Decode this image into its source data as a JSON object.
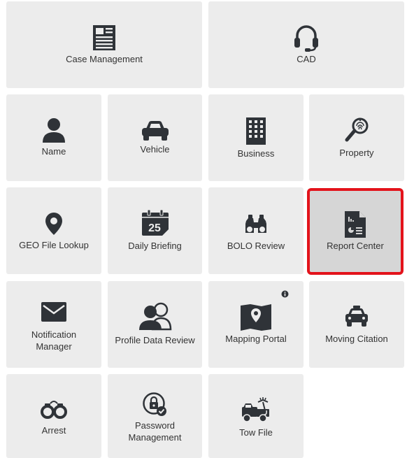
{
  "colors": {
    "tile_bg": "#ececec",
    "icon": "#2f3338",
    "selected_bg": "#d6d6d6",
    "selected_border": "#e3131b"
  },
  "tiles": {
    "case_management": {
      "label": "Case Management",
      "icon": "document-icon"
    },
    "cad": {
      "label": "CAD",
      "icon": "headset-icon"
    },
    "name": {
      "label": "Name",
      "icon": "person-icon"
    },
    "vehicle": {
      "label": "Vehicle",
      "icon": "car-icon"
    },
    "business": {
      "label": "Business",
      "icon": "building-icon"
    },
    "property": {
      "label": "Property",
      "icon": "fingerprint-magnifier-icon"
    },
    "geo_file_lookup": {
      "label": "GEO File Lookup",
      "icon": "map-pin-icon"
    },
    "daily_briefing": {
      "label": "Daily Briefing",
      "icon": "calendar-icon",
      "calendar_day": "25"
    },
    "bolo_review": {
      "label": "BOLO Review",
      "icon": "binoculars-icon"
    },
    "report_center": {
      "label": "Report Center",
      "icon": "report-chart-icon",
      "selected": true
    },
    "notification_manager": {
      "label_line1": "Notification",
      "label_line2": "Manager",
      "icon": "envelope-icon"
    },
    "profile_data_review": {
      "label": "Profile Data Review",
      "icon": "people-icon"
    },
    "mapping_portal": {
      "label": "Mapping Portal",
      "icon": "folded-map-icon",
      "badge": "info-icon"
    },
    "moving_citation": {
      "label": "Moving Citation",
      "icon": "police-car-icon"
    },
    "arrest": {
      "label": "Arrest",
      "icon": "handcuffs-icon"
    },
    "password_management": {
      "label_line1": "Password",
      "label_line2": "Management",
      "icon": "lock-check-icon"
    },
    "tow_file": {
      "label": "Tow File",
      "icon": "tow-truck-icon"
    }
  }
}
